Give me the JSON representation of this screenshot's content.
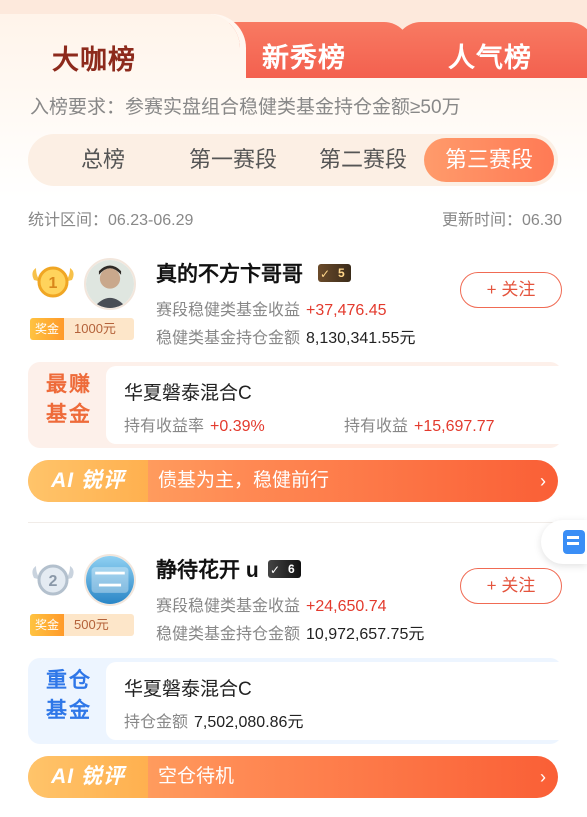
{
  "tabs": [
    {
      "label": "大咖榜",
      "active": true
    },
    {
      "label": "新秀榜",
      "active": false
    },
    {
      "label": "人气榜",
      "active": false
    }
  ],
  "requirement": "入榜要求：参赛实盘组合稳健类基金持仓金额≥50万",
  "segments": [
    "总榜",
    "第一赛段",
    "第二赛段",
    "第三赛段"
  ],
  "stat_period": "统计区间：06.23-06.29",
  "update_time": "更新时间：06.30",
  "entries": [
    {
      "rank": "1",
      "name": "真的不方卞哥哥",
      "badge": "5",
      "prize_tag": "奖金",
      "prize_amount": "1000元",
      "follow_label": "+ 关注",
      "income_label": "赛段稳健类基金收益",
      "income_value": "+37,476.45",
      "holding_label": "稳健类基金持仓金额",
      "holding_value": "8,130,341.55元",
      "fund_tag_line1": "最赚",
      "fund_tag_line2": "基金",
      "fund_name": "华夏磐泰混合C",
      "fund_stat1_label": "持有收益率",
      "fund_stat1_value": "+0.39%",
      "fund_stat2_label": "持有收益",
      "fund_stat2_value": "+15,697.77",
      "ai_tag": "AI 锐评",
      "ai_text": "债基为主，稳健前行"
    },
    {
      "rank": "2",
      "name": "静待花开 u",
      "badge": "6",
      "prize_tag": "奖金",
      "prize_amount": "500元",
      "follow_label": "+ 关注",
      "income_label": "赛段稳健类基金收益",
      "income_value": "+24,650.74",
      "holding_label": "稳健类基金持仓金额",
      "holding_value": "10,972,657.75元",
      "fund_tag_line1": "重仓",
      "fund_tag_line2": "基金",
      "fund_name": "华夏磐泰混合C",
      "fund_stat1_label": "持仓金额",
      "fund_stat1_value": "7,502,080.86元",
      "ai_tag": "AI 锐评",
      "ai_text": "空仓待机"
    }
  ],
  "colors": {
    "accent": "#f25a4a",
    "positive": "#e33a2d",
    "segment_active": "#ff8a5e",
    "blue_tag": "#2f77e8"
  }
}
